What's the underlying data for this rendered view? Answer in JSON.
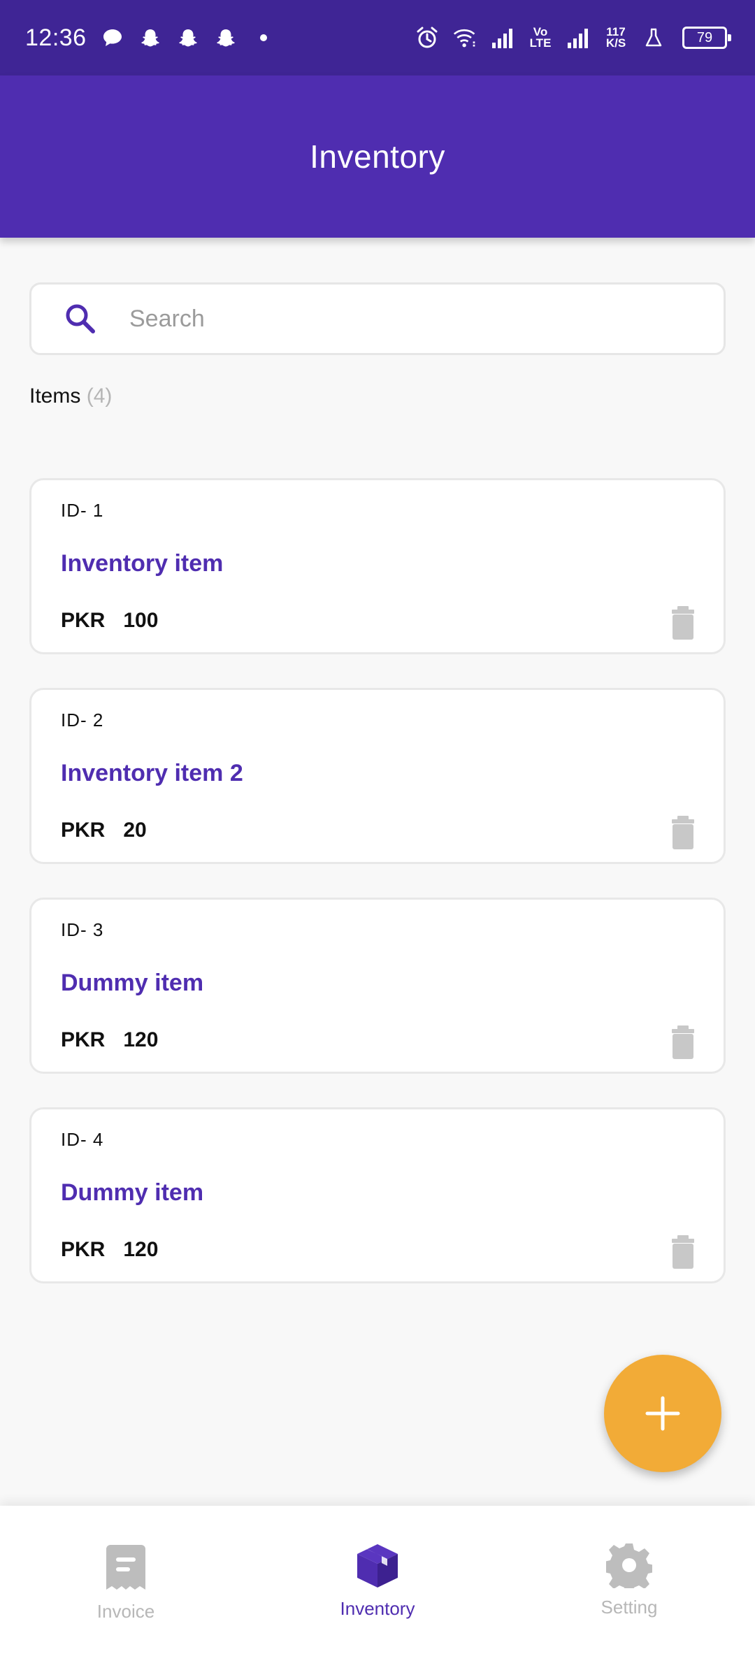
{
  "status_bar": {
    "time": "12:36",
    "left_icons": [
      "chat-bubble-icon",
      "snapchat-icon",
      "snapchat-icon",
      "snapchat-icon",
      "dot-icon"
    ],
    "right_icons": [
      "alarm-icon",
      "wifi-icon",
      "signal-icon",
      "volte-icon",
      "signal-icon",
      "network-speed-icon",
      "flask-icon",
      "battery-icon"
    ],
    "volte_top": "Vo",
    "volte_bottom": "LTE",
    "speed_value": "117",
    "speed_unit": "K/S",
    "battery": "79"
  },
  "app_bar": {
    "title": "Inventory"
  },
  "search": {
    "placeholder": "Search",
    "value": ""
  },
  "items_header": {
    "label": "Items",
    "count": "(4)"
  },
  "items": [
    {
      "id": "ID- 1",
      "name": "Inventory item",
      "currency": "PKR",
      "price": "100"
    },
    {
      "id": "ID- 2",
      "name": "Inventory item 2",
      "currency": "PKR",
      "price": "20"
    },
    {
      "id": "ID- 3",
      "name": "Dummy item",
      "currency": "PKR",
      "price": "120"
    },
    {
      "id": "ID- 4",
      "name": "Dummy item",
      "currency": "PKR",
      "price": "120"
    }
  ],
  "fab": {
    "icon": "plus-icon"
  },
  "bottom_nav": {
    "items": [
      {
        "label": "Invoice",
        "icon": "receipt-icon",
        "active": false
      },
      {
        "label": "Inventory",
        "icon": "box-icon",
        "active": true
      },
      {
        "label": "Setting",
        "icon": "gear-icon",
        "active": false
      }
    ]
  },
  "colors": {
    "primary": "#4f2db0",
    "status_bar": "#3f2595",
    "fab": "#f2ab37",
    "inactive": "#b7b7b7",
    "trash": "#c8c8c8"
  }
}
